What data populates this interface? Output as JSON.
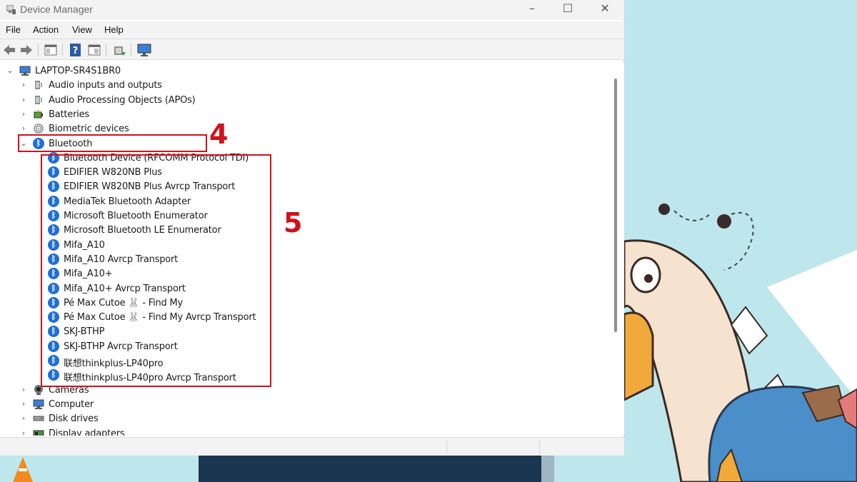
{
  "window": {
    "title": "Device Manager",
    "controls": {
      "minimize": "–",
      "maximize": "☐",
      "close": "✕"
    }
  },
  "menu": [
    "File",
    "Action",
    "View",
    "Help"
  ],
  "toolbar": {
    "icons": [
      "back-arrow-icon",
      "forward-arrow-icon",
      "properties-pane-icon",
      "help-icon",
      "driver-view-icon",
      "update-driver-icon",
      "monitor-scan-icon"
    ]
  },
  "tree": {
    "root": "LAPTOP-SR4S1BR0",
    "categories_before": [
      {
        "label": "Audio inputs and outputs",
        "icon": "speaker-icon"
      },
      {
        "label": "Audio Processing Objects (APOs)",
        "icon": "speaker-icon"
      },
      {
        "label": "Batteries",
        "icon": "battery-icon"
      },
      {
        "label": "Biometric devices",
        "icon": "fingerprint-icon"
      }
    ],
    "expanded": {
      "label": "Bluetooth",
      "icon": "bluetooth-icon"
    },
    "bluetooth_devices": [
      "Bluetooth Device (RFCOMM Protocol TDI)",
      "EDIFIER W820NB Plus",
      "EDIFIER W820NB Plus Avrcp Transport",
      "MediaTek Bluetooth Adapter",
      "Microsoft Bluetooth Enumerator",
      "Microsoft Bluetooth LE Enumerator",
      "Mifa_A10",
      "Mifa_A10 Avrcp Transport",
      "Mifa_A10+",
      "Mifa_A10+ Avrcp Transport",
      "Pé Max Cutoe 🐰 - Find My",
      "Pé Max Cutoe 🐰 - Find My Avrcp Transport",
      "SKJ-BTHP",
      "SKJ-BTHP Avrcp Transport",
      "联想thinkplus-LP40pro",
      "联想thinkplus-LP40pro Avrcp Transport"
    ],
    "categories_after": [
      {
        "label": "Cameras",
        "icon": "camera-icon"
      },
      {
        "label": "Computer",
        "icon": "computer-icon"
      },
      {
        "label": "Disk drives",
        "icon": "disk-drive-icon"
      },
      {
        "label": "Display adapters",
        "icon": "display-adapter-icon"
      }
    ]
  },
  "annotations": {
    "step4": "4",
    "step5": "5"
  },
  "colors": {
    "annotation": "#d0121b",
    "bluetooth": "#1f6fd6"
  }
}
